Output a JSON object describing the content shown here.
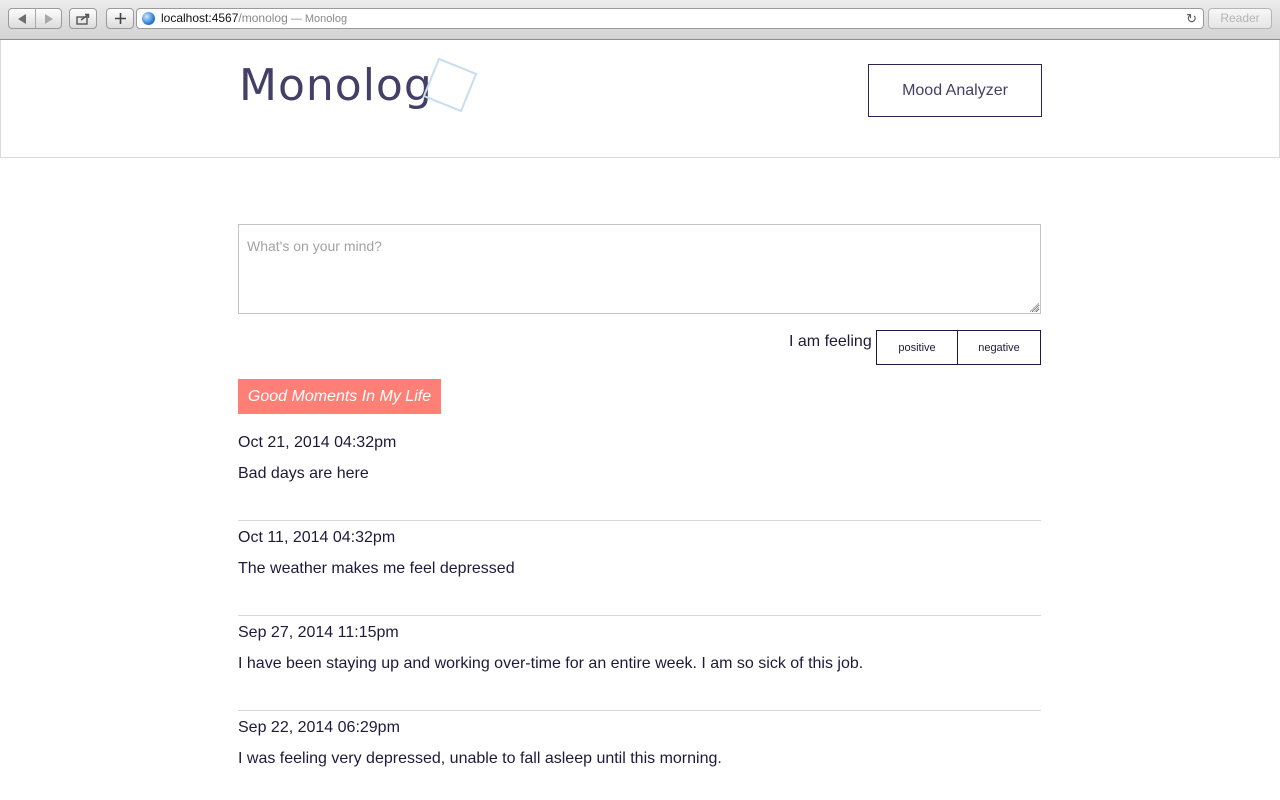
{
  "browser": {
    "address_host": "localhost:4567",
    "address_path": "/monolog",
    "address_title": " — Monolog",
    "reader_label": "Reader"
  },
  "header": {
    "logo_text": "Monolog",
    "mood_button_label": "Mood Analyzer"
  },
  "composer": {
    "placeholder": "What's on your mind?",
    "value": ""
  },
  "feeling": {
    "label": "I am feeling",
    "positive_label": "positive",
    "negative_label": "negative"
  },
  "filter": {
    "label": "Good Moments In My Life",
    "color": "#fd7f76"
  },
  "entries": [
    {
      "date": "Oct 21, 2014 04:32pm",
      "text": "Bad days are here"
    },
    {
      "date": "Oct 11, 2014 04:32pm",
      "text": "The weather makes me feel depressed"
    },
    {
      "date": "Sep 27, 2014 11:15pm",
      "text": "I have been staying up and working over-time for an entire week. I am so sick of this job."
    },
    {
      "date": "Sep 22, 2014 06:29pm",
      "text": "I was feeling very depressed, unable to fall asleep until this morning."
    }
  ],
  "icons": {
    "back": "back-arrow-icon",
    "forward": "forward-arrow-icon",
    "share": "share-icon",
    "new_tab": "plus-icon",
    "site": "globe-icon",
    "reload": "reload-icon"
  }
}
